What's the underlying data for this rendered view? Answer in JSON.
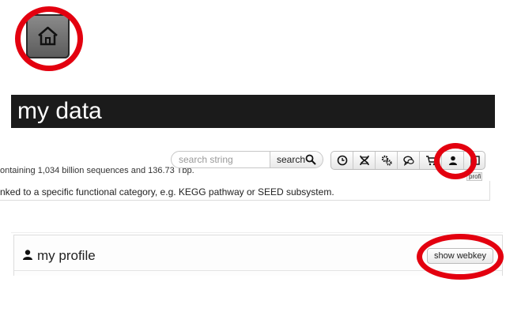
{
  "home": {
    "icon": "home-icon"
  },
  "header": {
    "title": "my data"
  },
  "search": {
    "placeholder": "search string",
    "button_label": "search",
    "button_icon": "magnifier-icon"
  },
  "stats_text": "ontaining 1,034 billion sequences and 136.73 Tbp.",
  "toolbar": {
    "items": [
      {
        "icon": "clock-icon"
      },
      {
        "icon": "dna-icon"
      },
      {
        "icon": "gears-icon"
      },
      {
        "icon": "chat-icon"
      },
      {
        "icon": "cart-icon"
      },
      {
        "icon": "user-icon"
      },
      {
        "icon": "book-icon"
      }
    ],
    "tooltip": "profile"
  },
  "description": "nked to a specific functional category, e.g. KEGG pathway or SEED subsystem.",
  "profile": {
    "title": "my profile",
    "webkey_button": "show webkey",
    "icon": "user-icon"
  },
  "colors": {
    "highlight": "#e3000f",
    "header_bg": "#1b1b1b"
  }
}
